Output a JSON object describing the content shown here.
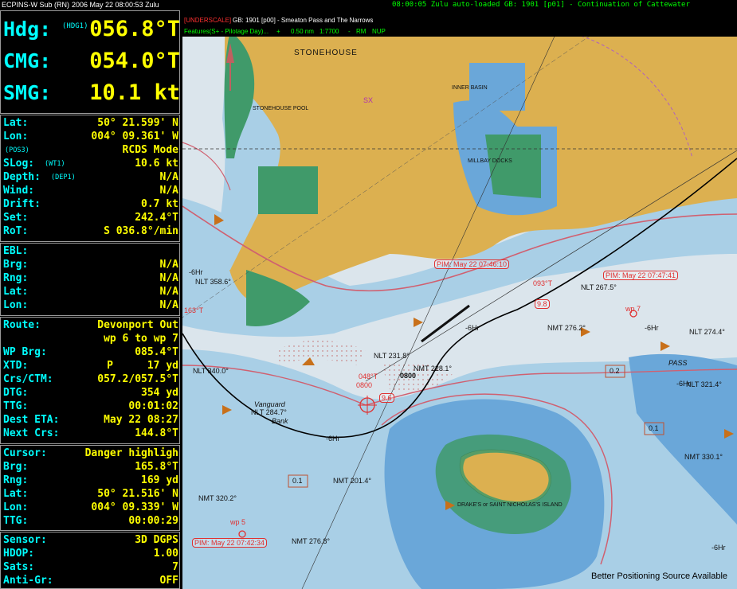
{
  "title_bar": {
    "app": "ECPINS-W Sub (RN)",
    "datetime": "2006 May 22   08:00:53 Zulu",
    "message": "08:00:05 Zulu auto-loaded GB: 1901 [p01] - Continuation of Cattewater"
  },
  "heading": {
    "hdg_label": "Hdg:",
    "hdg_source": "(HDG1)",
    "hdg_value": "056.8°T",
    "cmg_label": "CMG:",
    "cmg_value": "054.0°T",
    "smg_label": "SMG:",
    "smg_value": "10.1 kt"
  },
  "position": {
    "lat_label": "Lat:",
    "lat_value": "50° 21.599' N",
    "lon_label": "Lon:",
    "lon_value": "004° 09.361' W",
    "pos_source": "(POS3)",
    "mode": "RCDS Mode",
    "slog_label": "SLog:",
    "slog_source": "(WT1)",
    "slog_value": "10.6 kt",
    "depth_label": "Depth:",
    "depth_source": "(DEP1)",
    "depth_value": "N/A",
    "wind_label": "Wind:",
    "wind_value": "N/A",
    "drift_label": "Drift:",
    "drift_value": "0.7 kt",
    "set_label": "Set:",
    "set_value": "242.4°T",
    "rot_label": "RoT:",
    "rot_value": "S 036.8°/min"
  },
  "ebl": {
    "ebl_label": "EBL:",
    "brg_label": "Brg:",
    "brg_value": "N/A",
    "rng_label": "Rng:",
    "rng_value": "N/A",
    "lat_label": "Lat:",
    "lat_value": "N/A",
    "lon_label": "Lon:",
    "lon_value": "N/A"
  },
  "route": {
    "route_label": "Route:",
    "route_name": "Devonport Out",
    "waypoints": "wp 6 to wp 7",
    "wpbrg_label": "WP Brg:",
    "wpbrg_value": "085.4°T",
    "xtd_label": "XTD:",
    "xtd_side": "P",
    "xtd_value": "17 yd",
    "crs_label": "Crs/CTM:",
    "crs_value": "057.2/057.5°T",
    "dtg_label": "DTG:",
    "dtg_value": "354 yd",
    "ttg_label": "TTG:",
    "ttg_value": "00:01:02",
    "eta_label": "Dest ETA:",
    "eta_value": "May 22 08:27",
    "next_label": "Next Crs:",
    "next_value": "144.8°T"
  },
  "cursor": {
    "cursor_label": "Cursor:",
    "cursor_value": "Danger highligh",
    "brg_label": "Brg:",
    "brg_value": "165.8°T",
    "rng_label": "Rng:",
    "rng_value": "169 yd",
    "lat_label": "Lat:",
    "lat_value": "50° 21.516' N",
    "lon_label": "Lon:",
    "lon_value": "004° 09.339' W",
    "ttg_label": "TTG:",
    "ttg_value": "00:00:29"
  },
  "sensor": {
    "sensor_label": "Sensor:",
    "sensor_value": "3D DGPS",
    "hdop_label": "HDOP:",
    "hdop_value": "1.00",
    "sats_label": "Sats:",
    "sats_value": "7",
    "antigr_label": "Anti-Gr:",
    "antigr_value": "OFF"
  },
  "chart_header": {
    "underscale": "[UNDERSCALE]",
    "chart_id": "GB:   1901  [p00] - Smeaton Pass and The Narrows",
    "features": "Features(S+ - Pilotage Day)...",
    "plus": "+",
    "range": "0.50 nm",
    "scale": "1:7700",
    "separator": "-",
    "rm": "RM",
    "nup": "NUP"
  },
  "chart_labels": {
    "stonehouse": "STONEHOUSE",
    "stonehouse_pool": "STONEHOUSE POOL",
    "inner_basin": "INNER BASIN",
    "millbay_docks": "MILLBAY DOCKS",
    "island": "DRAKE'S or SAINT NICHOLAS'S ISLAND",
    "sx": "SX",
    "vanguard": "Vanguard",
    "bank": "Bank",
    "pass": "PASS",
    "hr1": "-6Hr",
    "hr2": "-6Hr",
    "hr3": "-6Hr",
    "hr4": "-6Hr",
    "hr5": "-6Hr",
    "hr6": "-6Hr",
    "b01a": "0.1",
    "b01b": "0.1",
    "b02": "0.2",
    "nlt267": "NLT 267.5°",
    "nmt276a": "NMT 276.2°",
    "nlt274": "NLT 274.4°",
    "nlt231": "NLT 231.8°",
    "nmt228": "NMT 228.1°",
    "nlt340": "NLT 340.0°",
    "nlt284": "NLT 284.7°",
    "nmt201": "NMT 201.4°",
    "nmt320": "NMT 320.2°",
    "nlt321": "NLT 321.4°",
    "nmt330": "NMT 330.1°",
    "nmt276b": "NMT 276.8°",
    "nlt358": "NLT 358.6°",
    "c0800": "0800",
    "p0800": "0800",
    "v96": "9.6",
    "v98": "9.8",
    "deg093": "093°T",
    "deg048": "048°T",
    "deg163": "163°T",
    "pim1": "PIM: May 22 07:46:10",
    "pim2": "PIM: May 22 07:47:41",
    "pim3": "PIM: May 22 07:42:34",
    "wp5": "wp 5",
    "wp7": "wp 7"
  },
  "notice": "Better Positioning Source Available",
  "colors": {
    "label": "#00ffff",
    "value": "#ffff00",
    "status": "#00ff00",
    "land": "#dcb050",
    "shallow": "#6aa7d9",
    "mid": "#a9cfe6",
    "deep": "#dbe5ec",
    "intertidal": "#409a6a",
    "route": "#000000",
    "pim": "#e03030"
  }
}
